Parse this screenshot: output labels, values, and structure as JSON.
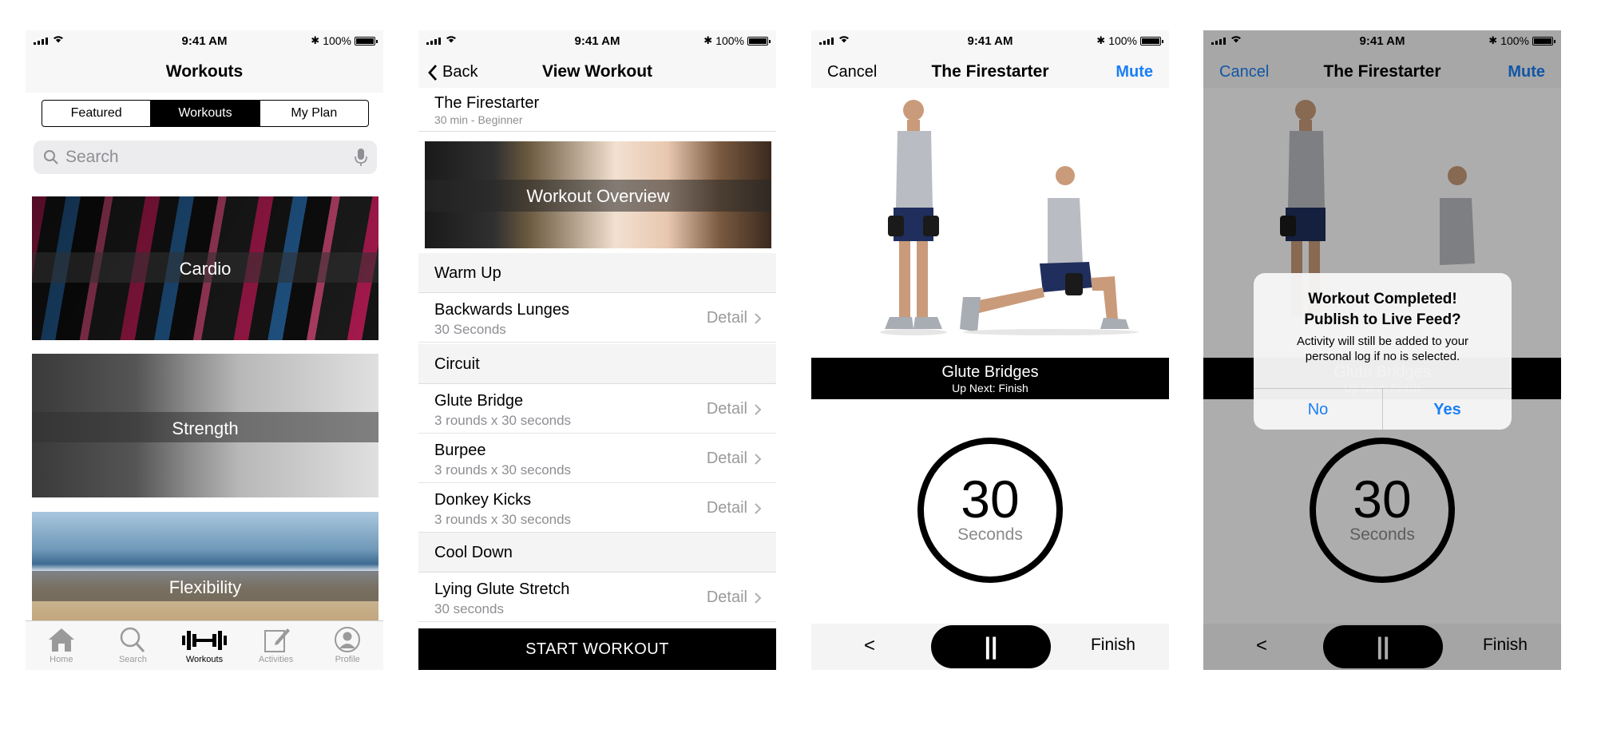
{
  "status": {
    "time": "9:41 AM",
    "battery": "100%"
  },
  "screen1": {
    "title": "Workouts",
    "segments": [
      "Featured",
      "Workouts",
      "My Plan"
    ],
    "search_placeholder": "Search",
    "categories": [
      "Cardio",
      "Strength",
      "Flexibility"
    ],
    "tabs": [
      "Home",
      "Search",
      "Workouts",
      "Activities",
      "Profile"
    ]
  },
  "screen2": {
    "back": "Back",
    "title": "View Workout",
    "workout_name": "The Firestarter",
    "workout_meta": "30 min - Beginner",
    "overview_label": "Workout Overview",
    "sections": {
      "warmup": "Warm Up",
      "circuit": "Circuit",
      "cooldown": "Cool Down"
    },
    "items": [
      {
        "name": "Backwards Lunges",
        "detail": "30 Seconds"
      },
      {
        "name": "Glute Bridge",
        "detail": "3 rounds x 30 seconds"
      },
      {
        "name": "Burpee",
        "detail": "3 rounds x 30 seconds"
      },
      {
        "name": "Donkey Kicks",
        "detail": "3 rounds x 30 seconds"
      },
      {
        "name": "Lying Glute Stretch",
        "detail": "30 seconds"
      }
    ],
    "detail_label": "Detail",
    "cta": "START WORKOUT"
  },
  "screen3": {
    "cancel": "Cancel",
    "title": "The Firestarter",
    "mute": "Mute",
    "exercise": "Glute Bridges",
    "up_next": "Up Next: Finish",
    "timer_value": "30",
    "timer_unit": "Seconds",
    "prev": "<",
    "pause": "||",
    "finish": "Finish"
  },
  "screen4": {
    "alert_title_1": "Workout Completed!",
    "alert_title_2": "Publish to Live Feed?",
    "alert_message": "Activity will still be added to your personal log if no is selected.",
    "no": "No",
    "yes": "Yes"
  },
  "colors": {
    "accent": "#1a7ff5"
  }
}
